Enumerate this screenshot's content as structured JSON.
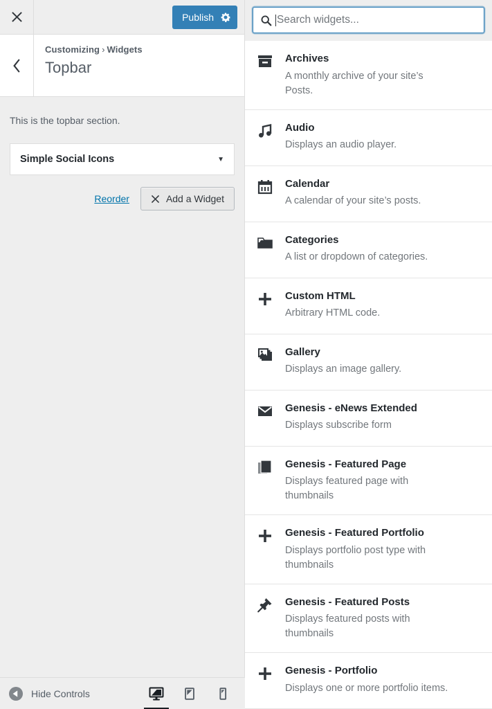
{
  "customizer": {
    "close_label": "Close customizer",
    "publish_label": "Publish",
    "publish_color": "#3380b6",
    "back_label": "Back",
    "breadcrumb_root": "Customizing",
    "breadcrumb_separator": "›",
    "breadcrumb_current": "Widgets",
    "section_title": "Topbar",
    "section_description": "This is the topbar section.",
    "widget_chip": {
      "name": "Simple Social Icons",
      "caret": "▼"
    },
    "reorder_label": "Reorder",
    "add_widget_label": "Add a Widget",
    "footer": {
      "hide_controls_label": "Hide Controls",
      "devices": [
        {
          "name": "desktop",
          "active": true
        },
        {
          "name": "tablet",
          "active": false
        },
        {
          "name": "mobile",
          "active": false
        }
      ]
    }
  },
  "picker": {
    "search_placeholder": "Search widgets...",
    "search_value": "",
    "widgets": [
      {
        "icon": "archives-icon",
        "name": "Archives",
        "desc": "A monthly archive of your site’s Posts."
      },
      {
        "icon": "audio-icon",
        "name": "Audio",
        "desc": "Displays an audio player."
      },
      {
        "icon": "calendar-icon",
        "name": "Calendar",
        "desc": "A calendar of your site’s posts."
      },
      {
        "icon": "categories-icon",
        "name": "Categories",
        "desc": "A list or dropdown of categories."
      },
      {
        "icon": "plus-icon",
        "name": "Custom HTML",
        "desc": "Arbitrary HTML code."
      },
      {
        "icon": "gallery-icon",
        "name": "Gallery",
        "desc": "Displays an image gallery."
      },
      {
        "icon": "email-icon",
        "name": "Genesis - eNews Extended",
        "desc": "Displays subscribe form"
      },
      {
        "icon": "pages-icon",
        "name": "Genesis - Featured Page",
        "desc": "Displays featured page with thumbnails"
      },
      {
        "icon": "plus-icon",
        "name": "Genesis - Featured Portfolio",
        "desc": "Displays portfolio post type with thumbnails"
      },
      {
        "icon": "pin-icon",
        "name": "Genesis - Featured Posts",
        "desc": "Displays featured posts with thumbnails"
      },
      {
        "icon": "plus-icon",
        "name": "Genesis - Portfolio",
        "desc": "Displays one or more portfolio items."
      }
    ]
  }
}
